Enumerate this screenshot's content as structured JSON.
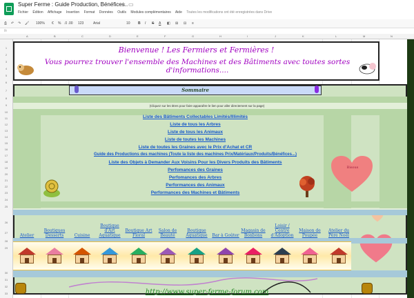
{
  "window": {
    "title": "Super Ferme : Guide Production, Bénéfices..",
    "menus": [
      "Fichier",
      "Édition",
      "Affichage",
      "Insertion",
      "Format",
      "Données",
      "Outils",
      "Modules complémentaires",
      "Aide"
    ],
    "save_status": "Toutes les modifications ont été enregistrées dans Drive"
  },
  "toolbar": {
    "zoom": "100%",
    "currency": "€",
    "percent": "%",
    "decimals": ".0 .00",
    "number_format": "123",
    "font": "Arial",
    "font_size": "10"
  },
  "formula_bar": {
    "label": "fx"
  },
  "columns": [
    "A",
    "B",
    "C",
    "D",
    "E",
    "F",
    "G",
    "H",
    "I",
    "J",
    "K",
    "L",
    "M",
    "N"
  ],
  "rows": [
    "1",
    "2",
    "3",
    "4",
    "5",
    "6",
    "7",
    "8",
    "9",
    "10",
    "11",
    "12",
    "13",
    "14",
    "15",
    "16",
    "17",
    "18",
    "19",
    "20",
    "21",
    "22",
    "23",
    "24",
    "25",
    "26",
    "27",
    "28",
    "29",
    "30",
    "31",
    "32",
    "33"
  ],
  "banner": {
    "line1": "Bienvenue ! Les Fermiers et Fermières !",
    "line2": "Vous pourrez trouver l'ensemble des Machines et des Bâtiments avec toutes sortes d'informations...."
  },
  "sommaire": {
    "title": "Sommaire",
    "hint": "(Cliquez sur les titres pour faire apparaître le lien pour aller directement sur la page)"
  },
  "links": [
    "Liste des Bâtiments Collectables Limités/Illimités",
    "Liste de tous les Arbres",
    "Liste de tous les Animaux",
    "Liste de toutes les Machines",
    "Liste de toutes les Graines avec le Prix d'Achat et CR",
    "Guide des Productions des machines (Toute la liste des machines Prix/Matériaux/Produits/Bénéfices...)",
    "Liste des Objets à Demander Aux Voisins Pour les Divers Produits des Bâtiments",
    "Perfomances des Graines",
    "Perfomances des Arbres",
    "Performances des Animaux",
    "Performances des Machines et Bâtiments"
  ],
  "heart_label": "Bisous",
  "categories": [
    "Atelier",
    "Boutiques Desserts",
    "Cuisine",
    "Boutique d'Art Aquatique",
    "Boutique Art Floral",
    "Salon de Beauté",
    "Boutique Aquatique",
    "Bar à Goûter",
    "Magasin de Bonbons",
    "Loisir / Centre d'Adoption",
    "Maison de Poupée",
    "Atelier du Père Noël"
  ],
  "footer": "http://www.super-ferme-forum.com",
  "colors": {
    "banner_text": "#a000c0",
    "link": "#1155cc",
    "green_bg": "#cfe3c2",
    "sommaire_bg": "#c9daf8",
    "footer_text": "#228822"
  },
  "icons": [
    "sheet-icon",
    "star-icon",
    "folder-icon",
    "print-icon",
    "undo-icon",
    "redo-icon",
    "paint-format-icon",
    "bold-icon",
    "italic-icon",
    "strikethrough-icon",
    "text-color-icon",
    "fill-color-icon",
    "borders-icon",
    "merge-icon",
    "align-icon",
    "heart-icon",
    "cow-icon",
    "tree-icon",
    "barrel-icon",
    "building-icon"
  ]
}
